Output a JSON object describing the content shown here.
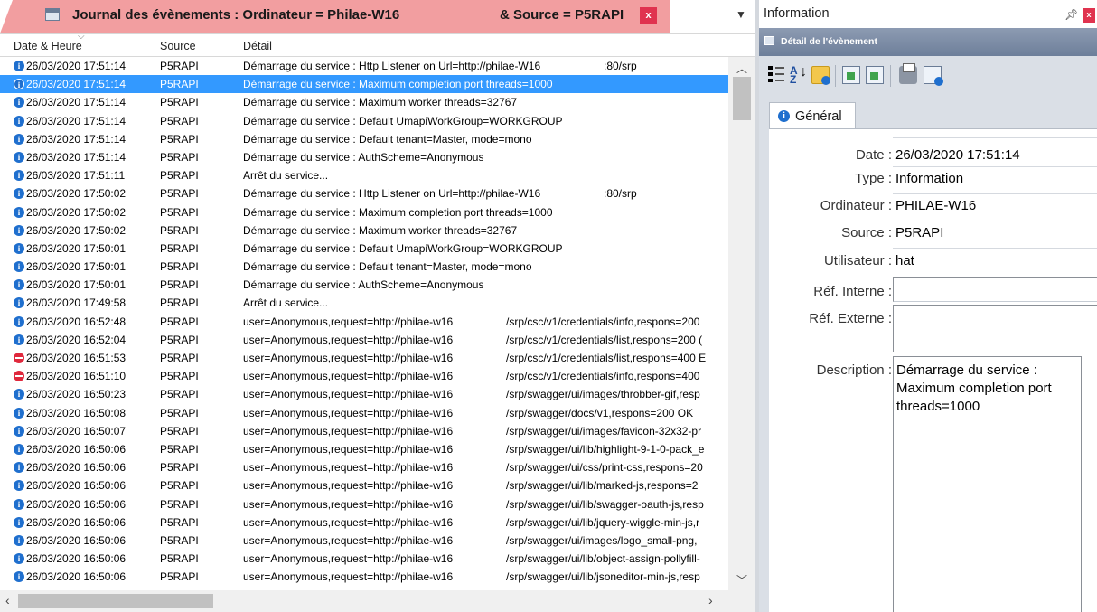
{
  "left_panel": {
    "title": "Journal des évènements : Ordinateur = Philae-W16",
    "title_source": "& Source = P5RAPI",
    "close_label": "x",
    "dropdown_icon": "dropdown-arrow-icon",
    "columns": [
      "Date & Heure",
      "Source",
      "Détail"
    ],
    "rows": [
      {
        "icon": "info",
        "date": "26/03/2020 17:51:14",
        "source": "P5RAPI",
        "detail": "Démarrage du service : Http Listener on Url=http://philae-W16",
        "extra": ":80/srp"
      },
      {
        "icon": "info",
        "date": "26/03/2020 17:51:14",
        "source": "P5RAPI",
        "detail": "Démarrage du service : Maximum completion port threads=1000",
        "extra": "",
        "selected": true
      },
      {
        "icon": "info",
        "date": "26/03/2020 17:51:14",
        "source": "P5RAPI",
        "detail": "Démarrage du service : Maximum worker threads=32767",
        "extra": ""
      },
      {
        "icon": "info",
        "date": "26/03/2020 17:51:14",
        "source": "P5RAPI",
        "detail": "Démarrage du service : Default UmapiWorkGroup=WORKGROUP",
        "extra": ""
      },
      {
        "icon": "info",
        "date": "26/03/2020 17:51:14",
        "source": "P5RAPI",
        "detail": "Démarrage du service : Default tenant=Master, mode=mono",
        "extra": ""
      },
      {
        "icon": "info",
        "date": "26/03/2020 17:51:14",
        "source": "P5RAPI",
        "detail": "Démarrage du service : AuthScheme=Anonymous",
        "extra": ""
      },
      {
        "icon": "info",
        "date": "26/03/2020 17:51:11",
        "source": "P5RAPI",
        "detail": "Arrêt du service...",
        "extra": ""
      },
      {
        "icon": "info",
        "date": "26/03/2020 17:50:02",
        "source": "P5RAPI",
        "detail": "Démarrage du service : Http Listener on Url=http://philae-W16",
        "extra": ":80/srp"
      },
      {
        "icon": "info",
        "date": "26/03/2020 17:50:02",
        "source": "P5RAPI",
        "detail": "Démarrage du service : Maximum completion port threads=1000",
        "extra": ""
      },
      {
        "icon": "info",
        "date": "26/03/2020 17:50:02",
        "source": "P5RAPI",
        "detail": "Démarrage du service : Maximum worker threads=32767",
        "extra": ""
      },
      {
        "icon": "info",
        "date": "26/03/2020 17:50:01",
        "source": "P5RAPI",
        "detail": "Démarrage du service : Default UmapiWorkGroup=WORKGROUP",
        "extra": ""
      },
      {
        "icon": "info",
        "date": "26/03/2020 17:50:01",
        "source": "P5RAPI",
        "detail": "Démarrage du service : Default tenant=Master, mode=mono",
        "extra": ""
      },
      {
        "icon": "info",
        "date": "26/03/2020 17:50:01",
        "source": "P5RAPI",
        "detail": "Démarrage du service : AuthScheme=Anonymous",
        "extra": ""
      },
      {
        "icon": "info",
        "date": "26/03/2020 17:49:58",
        "source": "P5RAPI",
        "detail": "Arrêt du service...",
        "extra": ""
      },
      {
        "icon": "info",
        "date": "26/03/2020 16:52:48",
        "source": "P5RAPI",
        "detail": "user=Anonymous,request=http://philae-w16",
        "url": "/srp/csc/v1/credentials/info,respons=200"
      },
      {
        "icon": "info",
        "date": "26/03/2020 16:52:04",
        "source": "P5RAPI",
        "detail": "user=Anonymous,request=http://philae-w16",
        "url": "/srp/csc/v1/credentials/list,respons=200 ("
      },
      {
        "icon": "error",
        "date": "26/03/2020 16:51:53",
        "source": "P5RAPI",
        "detail": "user=Anonymous,request=http://philae-w16",
        "url": "/srp/csc/v1/credentials/list,respons=400 E"
      },
      {
        "icon": "error",
        "date": "26/03/2020 16:51:10",
        "source": "P5RAPI",
        "detail": "user=Anonymous,request=http://philae-w16",
        "url": "/srp/csc/v1/credentials/info,respons=400"
      },
      {
        "icon": "info",
        "date": "26/03/2020 16:50:23",
        "source": "P5RAPI",
        "detail": "user=Anonymous,request=http://philae-w16",
        "url": "/srp/swagger/ui/images/throbber-gif,resp"
      },
      {
        "icon": "info",
        "date": "26/03/2020 16:50:08",
        "source": "P5RAPI",
        "detail": "user=Anonymous,request=http://philae-w16",
        "url": "/srp/swagger/docs/v1,respons=200 OK"
      },
      {
        "icon": "info",
        "date": "26/03/2020 16:50:07",
        "source": "P5RAPI",
        "detail": "user=Anonymous,request=http://philae-w16",
        "url": "/srp/swagger/ui/images/favicon-32x32-pr"
      },
      {
        "icon": "info",
        "date": "26/03/2020 16:50:06",
        "source": "P5RAPI",
        "detail": "user=Anonymous,request=http://philae-w16",
        "url": "/srp/swagger/ui/lib/highlight-9-1-0-pack_e"
      },
      {
        "icon": "info",
        "date": "26/03/2020 16:50:06",
        "source": "P5RAPI",
        "detail": "user=Anonymous,request=http://philae-w16",
        "url": "/srp/swagger/ui/css/print-css,respons=20"
      },
      {
        "icon": "info",
        "date": "26/03/2020 16:50:06",
        "source": "P5RAPI",
        "detail": "user=Anonymous,request=http://philae-w16",
        "url": "/srp/swagger/ui/lib/marked-js,respons=2"
      },
      {
        "icon": "info",
        "date": "26/03/2020 16:50:06",
        "source": "P5RAPI",
        "detail": "user=Anonymous,request=http://philae-w16",
        "url": "/srp/swagger/ui/lib/swagger-oauth-js,resp"
      },
      {
        "icon": "info",
        "date": "26/03/2020 16:50:06",
        "source": "P5RAPI",
        "detail": "user=Anonymous,request=http://philae-w16",
        "url": "/srp/swagger/ui/lib/jquery-wiggle-min-js,r"
      },
      {
        "icon": "info",
        "date": "26/03/2020 16:50:06",
        "source": "P5RAPI",
        "detail": "user=Anonymous,request=http://philae-w16",
        "url": "/srp/swagger/ui/images/logo_small-png,"
      },
      {
        "icon": "info",
        "date": "26/03/2020 16:50:06",
        "source": "P5RAPI",
        "detail": "user=Anonymous,request=http://philae-w16",
        "url": "/srp/swagger/ui/lib/object-assign-pollyfill-"
      },
      {
        "icon": "info",
        "date": "26/03/2020 16:50:06",
        "source": "P5RAPI",
        "detail": "user=Anonymous,request=http://philae-w16",
        "url": "/srp/swagger/ui/lib/jsoneditor-min-js,resp"
      }
    ]
  },
  "right_panel": {
    "title": "Information",
    "pin_icon": "pin-icon",
    "close_label": "x",
    "subheader": "Détail de l'évènement",
    "toolbar_icons": [
      "categorized-icon",
      "sort-az-icon",
      "folder-info-icon",
      "export-icon",
      "import-icon",
      "print-icon",
      "document-info-icon"
    ],
    "tab_label": "Général",
    "fields": {
      "date_label": "Date :",
      "date_value": "26/03/2020 17:51:14",
      "type_label": "Type :",
      "type_value": "Information",
      "ordinateur_label": "Ordinateur :",
      "ordinateur_value": "PHILAE-W16",
      "source_label": "Source :",
      "source_value": "P5RAPI",
      "utilisateur_label": "Utilisateur :",
      "utilisateur_value": "hat",
      "ref_interne_label": "Réf. Interne :",
      "ref_interne_value": "",
      "ref_externe_label": "Réf. Externe :",
      "ref_externe_value": "",
      "description_label": "Description :",
      "description_value": "Démarrage du service : Maximum completion port threads=1000"
    }
  },
  "colors": {
    "tab_bg": "#f29ea0",
    "selection": "#3399ff",
    "info_icon": "#1f6fce",
    "error_icon": "#e0283c",
    "panel_header": "#7d8ea8"
  }
}
